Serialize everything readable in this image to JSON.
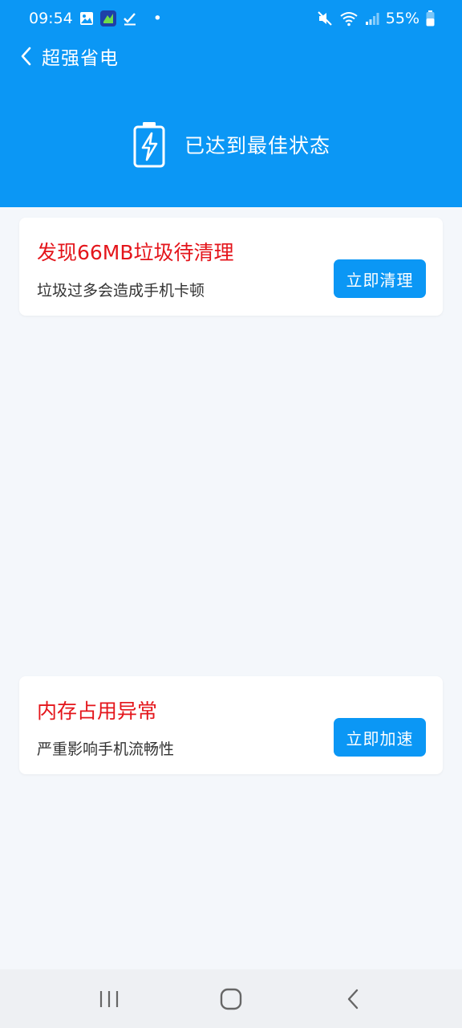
{
  "status_bar": {
    "time": "09:54",
    "dot": "•",
    "battery_text": "55%",
    "icons": [
      "gallery-icon",
      "app-notification-icon",
      "check-icon",
      "mute-icon",
      "wifi-icon",
      "signal-icon",
      "battery-icon"
    ]
  },
  "header": {
    "title": "超强省电",
    "status_text": "已达到最佳状态",
    "color": "#0b97f5"
  },
  "cards": [
    {
      "title": "发现66MB垃圾待清理",
      "subtitle": "垃圾过多会造成手机卡顿",
      "button": "立即清理"
    },
    {
      "title": "内存占用异常",
      "subtitle": "严重影响手机流畅性",
      "button": "立即加速"
    }
  ],
  "colors": {
    "accent": "#0b97f5",
    "alert": "#e4151b",
    "background": "#f4f7fb"
  }
}
